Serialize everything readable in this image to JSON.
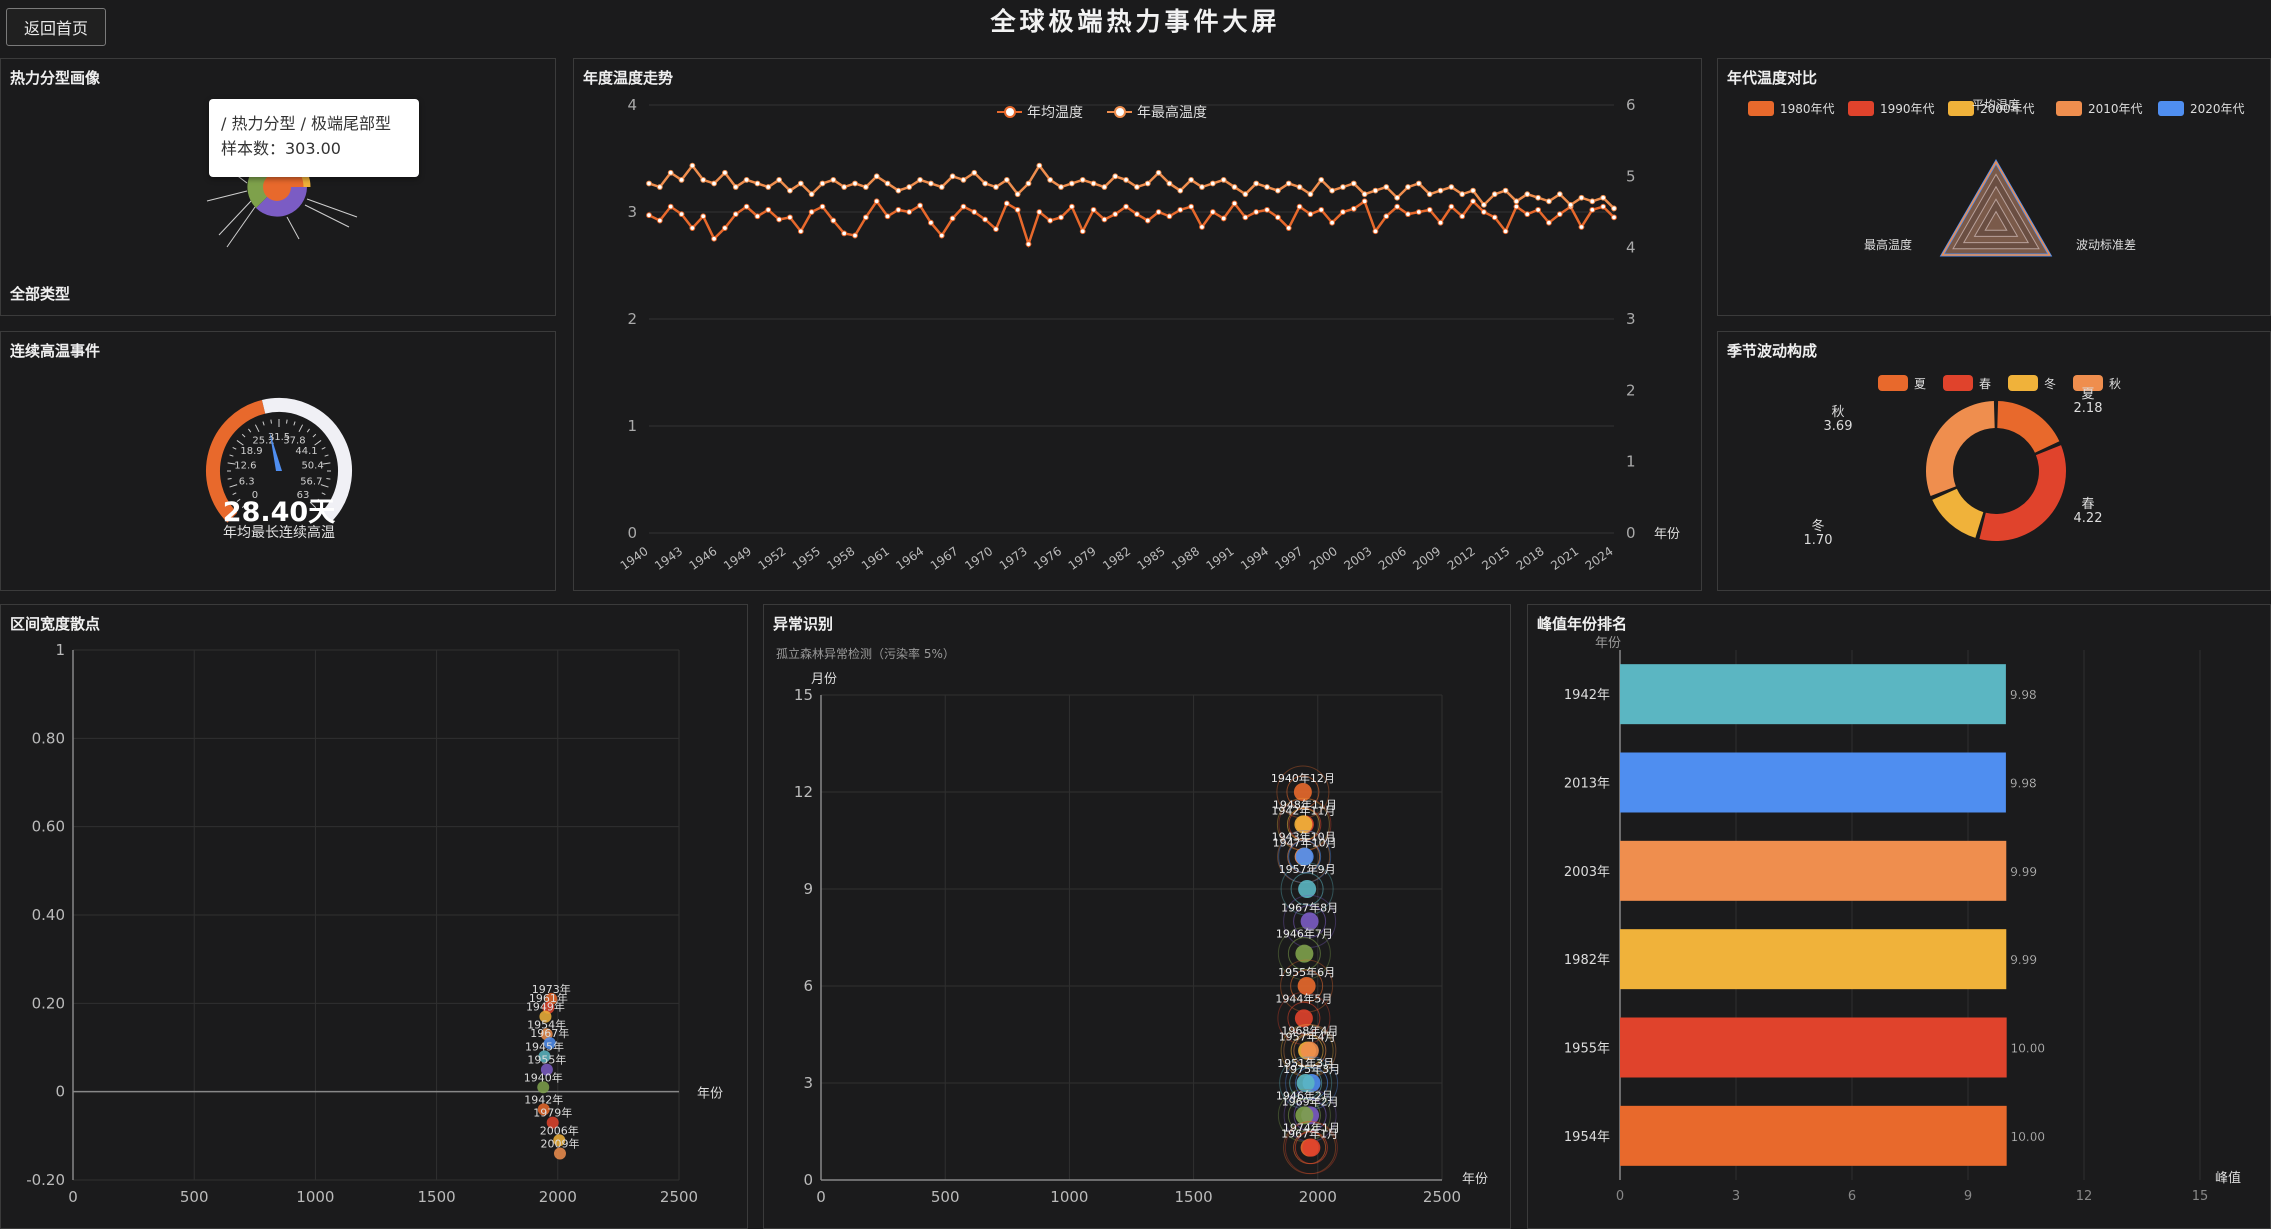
{
  "header": {
    "title": "全球极端热力事件大屏",
    "back_label": "返回首页"
  },
  "panels": {
    "heat_profile": {
      "title": "热力分型画像",
      "footer": "全部类型",
      "tooltip": {
        "path": "/ 热力分型 / 极端尾部型",
        "sample": "样本数：303.00"
      }
    },
    "streak": {
      "title": "连续高温事件",
      "value": "28.40天",
      "caption": "年均最长连续高温",
      "ticks": [
        "0",
        "6.3",
        "12.6",
        "18.9",
        "25.2",
        "31.5",
        "37.8",
        "44.1",
        "50.4",
        "56.7",
        "63"
      ],
      "fraction": 0.45
    },
    "trend": {
      "title": "年度温度走势",
      "legend": [
        "年均温度",
        "年最高温度"
      ],
      "x_axis_name": "年份"
    },
    "decade": {
      "title": "年代温度对比",
      "legend": [
        "1980年代",
        "1990年代",
        "2000年代",
        "2010年代",
        "2020年代"
      ],
      "indicators": [
        "平均温度",
        "最高温度",
        "波动标准差"
      ]
    },
    "season": {
      "title": "季节波动构成",
      "legend": [
        "夏",
        "春",
        "冬",
        "秋"
      ],
      "labels": [
        {
          "name": "秋",
          "value": "3.69"
        },
        {
          "name": "冬",
          "value": "1.70"
        },
        {
          "name": "春",
          "value": "4.22"
        },
        {
          "name": "夏",
          "value": "2.18"
        }
      ]
    },
    "scatter": {
      "title": "区间宽度散点",
      "x_axis_name": "年份"
    },
    "anomaly": {
      "title": "异常识别",
      "subtitle": "孤立森林异常检测（污染率 5%）",
      "y_axis_name": "月份",
      "x_axis_name": "年份"
    },
    "ranking": {
      "title": "峰值年份排名",
      "y_axis_name": "年份",
      "x_axis_name": "峰值"
    }
  },
  "colors": {
    "orange": "#e8692c",
    "red": "#e0432c",
    "yellow": "#f0b23a",
    "lightorange": "#ef8e4e",
    "blue": "#4f8ef0",
    "teal": "#5bb6c2",
    "purple": "#7b5cc4",
    "green": "#7ea14b"
  },
  "chart_data": [
    {
      "type": "line",
      "title": "年度温度走势",
      "x_ticks": [
        "1940",
        "1943",
        "1946",
        "1949",
        "1952",
        "1955",
        "1958",
        "1961",
        "1964",
        "1967",
        "1970",
        "1973",
        "1976",
        "1979",
        "1982",
        "1985",
        "1988",
        "1991",
        "1994",
        "1997",
        "2000",
        "2003",
        "2006",
        "2009",
        "2012",
        "2015",
        "2018",
        "2021",
        "2024"
      ],
      "ylim_left": [
        0,
        4
      ],
      "ylim_right": [
        0,
        6
      ],
      "series": [
        {
          "name": "年均温度",
          "axis": "left",
          "values": [
            2.97,
            2.92,
            3.05,
            2.98,
            2.85,
            2.96,
            2.75,
            2.85,
            2.98,
            3.05,
            2.96,
            3.02,
            2.93,
            2.95,
            2.82,
            3.0,
            3.05,
            2.92,
            2.8,
            2.78,
            2.95,
            3.1,
            2.96,
            3.02,
            3.0,
            3.06,
            2.9,
            2.78,
            2.94,
            3.05,
            3.0,
            2.93,
            2.84,
            3.08,
            3.02,
            2.7,
            3.0,
            2.92,
            2.95,
            3.05,
            2.82,
            3.02,
            2.93,
            2.98,
            3.05,
            2.98,
            2.92,
            3.0,
            2.96,
            3.02,
            3.05,
            2.86,
            3.0,
            2.94,
            3.08,
            2.95,
            3.0,
            3.02,
            2.95,
            2.85,
            3.05,
            2.98,
            3.02,
            2.9,
            3.0,
            3.03,
            3.1,
            2.82,
            2.96,
            3.05,
            2.98,
            3.0,
            3.02,
            2.9,
            3.05,
            2.96,
            3.1,
            3.0,
            2.95,
            2.82,
            3.05,
            2.98,
            3.02,
            2.9,
            2.98,
            3.05,
            2.86,
            3.02,
            3.05,
            2.95
          ]
        },
        {
          "name": "年最高温度",
          "axis": "right",
          "values": [
            4.9,
            4.85,
            5.05,
            4.95,
            5.15,
            4.95,
            4.9,
            5.05,
            4.85,
            4.95,
            4.9,
            4.85,
            4.95,
            4.8,
            4.9,
            4.75,
            4.9,
            4.95,
            4.85,
            4.9,
            4.85,
            5.0,
            4.9,
            4.8,
            4.85,
            4.95,
            4.9,
            4.85,
            5.0,
            4.95,
            5.05,
            4.9,
            4.85,
            4.95,
            4.75,
            4.9,
            5.15,
            4.95,
            4.85,
            4.9,
            4.95,
            4.9,
            4.85,
            5.0,
            4.95,
            4.85,
            4.9,
            5.05,
            4.9,
            4.8,
            4.95,
            4.85,
            4.9,
            4.95,
            4.85,
            4.75,
            4.9,
            4.85,
            4.8,
            4.9,
            4.85,
            4.75,
            4.95,
            4.8,
            4.85,
            4.9,
            4.75,
            4.8,
            4.85,
            4.7,
            4.85,
            4.9,
            4.75,
            4.8,
            4.85,
            4.75,
            4.8,
            4.6,
            4.75,
            4.8,
            4.65,
            4.75,
            4.7,
            4.65,
            4.75,
            4.6,
            4.7,
            4.65,
            4.7,
            4.55
          ]
        }
      ]
    },
    {
      "type": "bar",
      "title": "峰值年份排名",
      "categories": [
        "1942年",
        "2013年",
        "2003年",
        "1982年",
        "1955年",
        "1954年"
      ],
      "values": [
        9.98,
        9.98,
        9.99,
        9.99,
        10.0,
        10.0
      ],
      "value_labels": [
        "9.98",
        "9.98",
        "9.99",
        "9.99",
        "10.00",
        "10.00"
      ],
      "x_ticks": [
        "0",
        "3",
        "6",
        "9",
        "12",
        "15"
      ],
      "xlim": [
        0,
        15
      ]
    },
    {
      "type": "scatter",
      "title": "区间宽度散点",
      "x_ticks": [
        "0",
        "500",
        "1000",
        "1500",
        "2000",
        "2500"
      ],
      "y_ticks": [
        "1",
        "0.80",
        "0.60",
        "0.40",
        "0.20",
        "0",
        "-0.20"
      ],
      "xlim": [
        0,
        2500
      ],
      "ylim": [
        -0.2,
        1
      ],
      "points": [
        {
          "x": 1973,
          "y": 0.21,
          "label": "1973年"
        },
        {
          "x": 1961,
          "y": 0.19,
          "label": "1961年"
        },
        {
          "x": 1949,
          "y": 0.17,
          "label": "1949年"
        },
        {
          "x": 1954,
          "y": 0.13,
          "label": "1954年"
        },
        {
          "x": 1967,
          "y": 0.11,
          "label": "1967年"
        },
        {
          "x": 1945,
          "y": 0.08,
          "label": "1945年"
        },
        {
          "x": 1955,
          "y": 0.05,
          "label": "1955年"
        },
        {
          "x": 1940,
          "y": 0.01,
          "label": "1940年"
        },
        {
          "x": 1942,
          "y": -0.04,
          "label": "1942年"
        },
        {
          "x": 1979,
          "y": -0.07,
          "label": "1979年"
        },
        {
          "x": 2006,
          "y": -0.11,
          "label": "2006年"
        },
        {
          "x": 2009,
          "y": -0.14,
          "label": "2009年"
        }
      ]
    },
    {
      "type": "scatter",
      "title": "异常识别",
      "x_ticks": [
        "0",
        "500",
        "1000",
        "1500",
        "2000",
        "2500"
      ],
      "y_ticks": [
        "15",
        "12",
        "9",
        "6",
        "3",
        "0"
      ],
      "xlim": [
        0,
        2500
      ],
      "ylim": [
        0,
        15
      ],
      "points": [
        {
          "x": 1940,
          "y": 12,
          "label": "1940年12月"
        },
        {
          "x": 1948,
          "y": 11,
          "label": "1948年11月"
        },
        {
          "x": 1942,
          "y": 11,
          "label": "1942年11月"
        },
        {
          "x": 1943,
          "y": 10,
          "label": "1943年10月"
        },
        {
          "x": 1947,
          "y": 10,
          "label": "1947年10月"
        },
        {
          "x": 1957,
          "y": 9,
          "label": "1957年9月"
        },
        {
          "x": 1967,
          "y": 8,
          "label": "1967年8月"
        },
        {
          "x": 1946,
          "y": 7,
          "label": "1946年7月"
        },
        {
          "x": 1955,
          "y": 6,
          "label": "1955年6月"
        },
        {
          "x": 1944,
          "y": 5,
          "label": "1944年5月"
        },
        {
          "x": 1957,
          "y": 4,
          "label": "1957年4月"
        },
        {
          "x": 1968,
          "y": 4,
          "label": "1968年4月"
        },
        {
          "x": 1975,
          "y": 3,
          "label": "1975年3月"
        },
        {
          "x": 1951,
          "y": 3,
          "label": "1951年3月"
        },
        {
          "x": 1969,
          "y": 2,
          "label": "1969年2月"
        },
        {
          "x": 1946,
          "y": 2,
          "label": "1946年2月"
        },
        {
          "x": 1967,
          "y": 1,
          "label": "1967年1月"
        },
        {
          "x": 1974,
          "y": 1,
          "label": "1974年1月"
        }
      ]
    },
    {
      "type": "pie",
      "title": "季节波动构成",
      "categories": [
        "夏",
        "春",
        "冬",
        "秋"
      ],
      "values": [
        2.18,
        4.22,
        1.7,
        3.69
      ]
    }
  ]
}
